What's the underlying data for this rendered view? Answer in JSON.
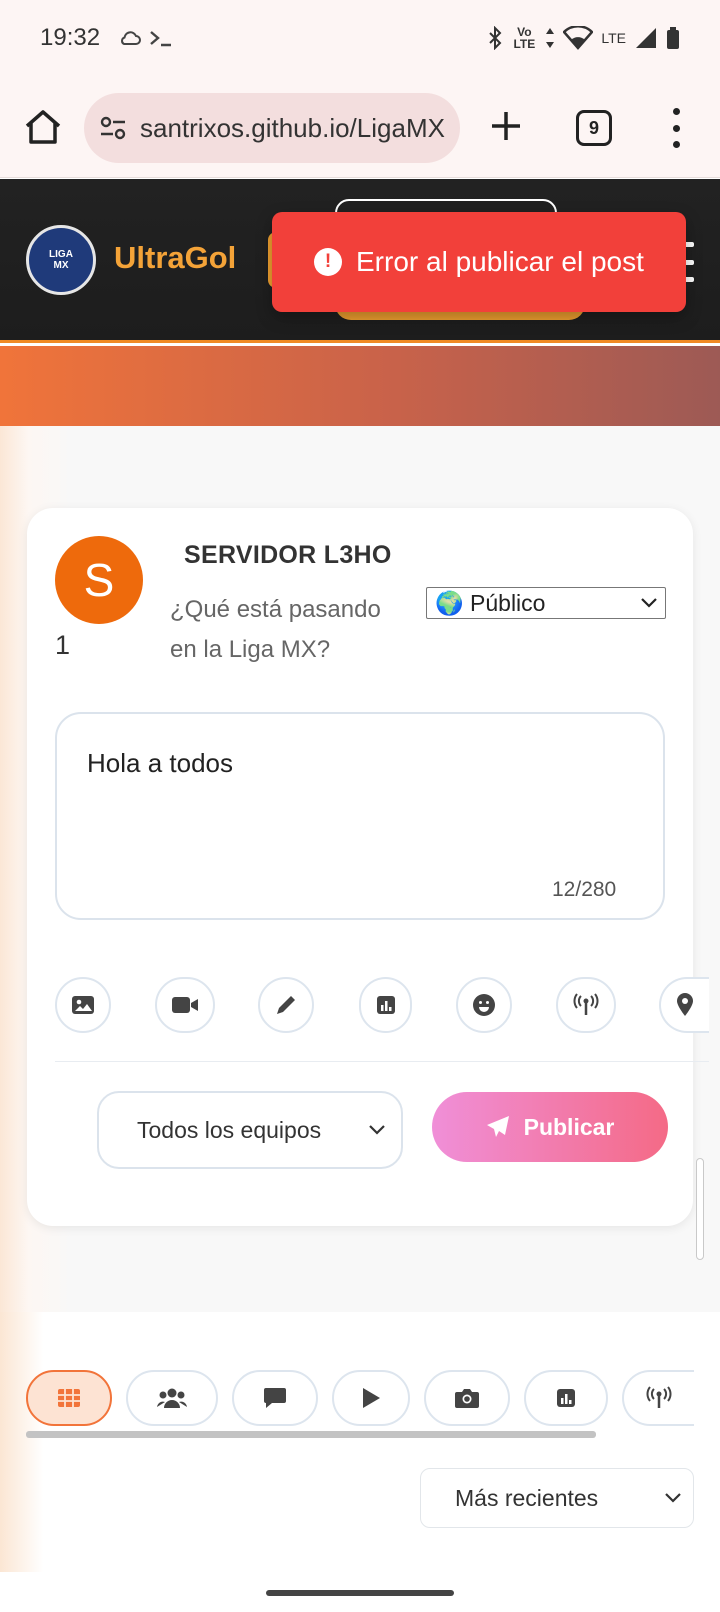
{
  "status_bar": {
    "time": "19:32",
    "left_icons": [
      "cloud-icon",
      "terminal-icon"
    ],
    "right_icons": [
      "bluetooth-icon",
      "volte-icon",
      "data-arrows-icon",
      "wifi-icon",
      "lte-signal-icon",
      "battery-icon"
    ],
    "volte_label": "Vo LTE",
    "lte_label": "LTE"
  },
  "browser": {
    "url": "santrixos.github.io/LigaMX",
    "tab_count": "9"
  },
  "header": {
    "brand": "UltraGol",
    "logo_text": "LIGA MX",
    "accent_color": "#f4a338"
  },
  "toast": {
    "message": "Error al publicar el post",
    "color": "#f2403a"
  },
  "composer": {
    "avatar_letter": "S",
    "avatar_count": "1",
    "username": "SERVIDOR L3HO",
    "prompt": "¿Qué está pasando en la Liga MX?",
    "privacy": "🌍 Público",
    "text": "Hola a todos",
    "char_counter": "12/280",
    "tools": [
      "image-icon",
      "video-icon",
      "pen-icon",
      "chart-icon",
      "emoji-icon",
      "broadcast-icon",
      "location-icon"
    ],
    "team_select": "Todos los equipos",
    "publish_label": "Publicar"
  },
  "feed_filters": {
    "chips": [
      "grid-icon",
      "users-icon",
      "comment-icon",
      "play-icon",
      "camera-icon",
      "chart-icon",
      "broadcast-icon"
    ],
    "active_index": 0,
    "sort": "Más recientes"
  }
}
